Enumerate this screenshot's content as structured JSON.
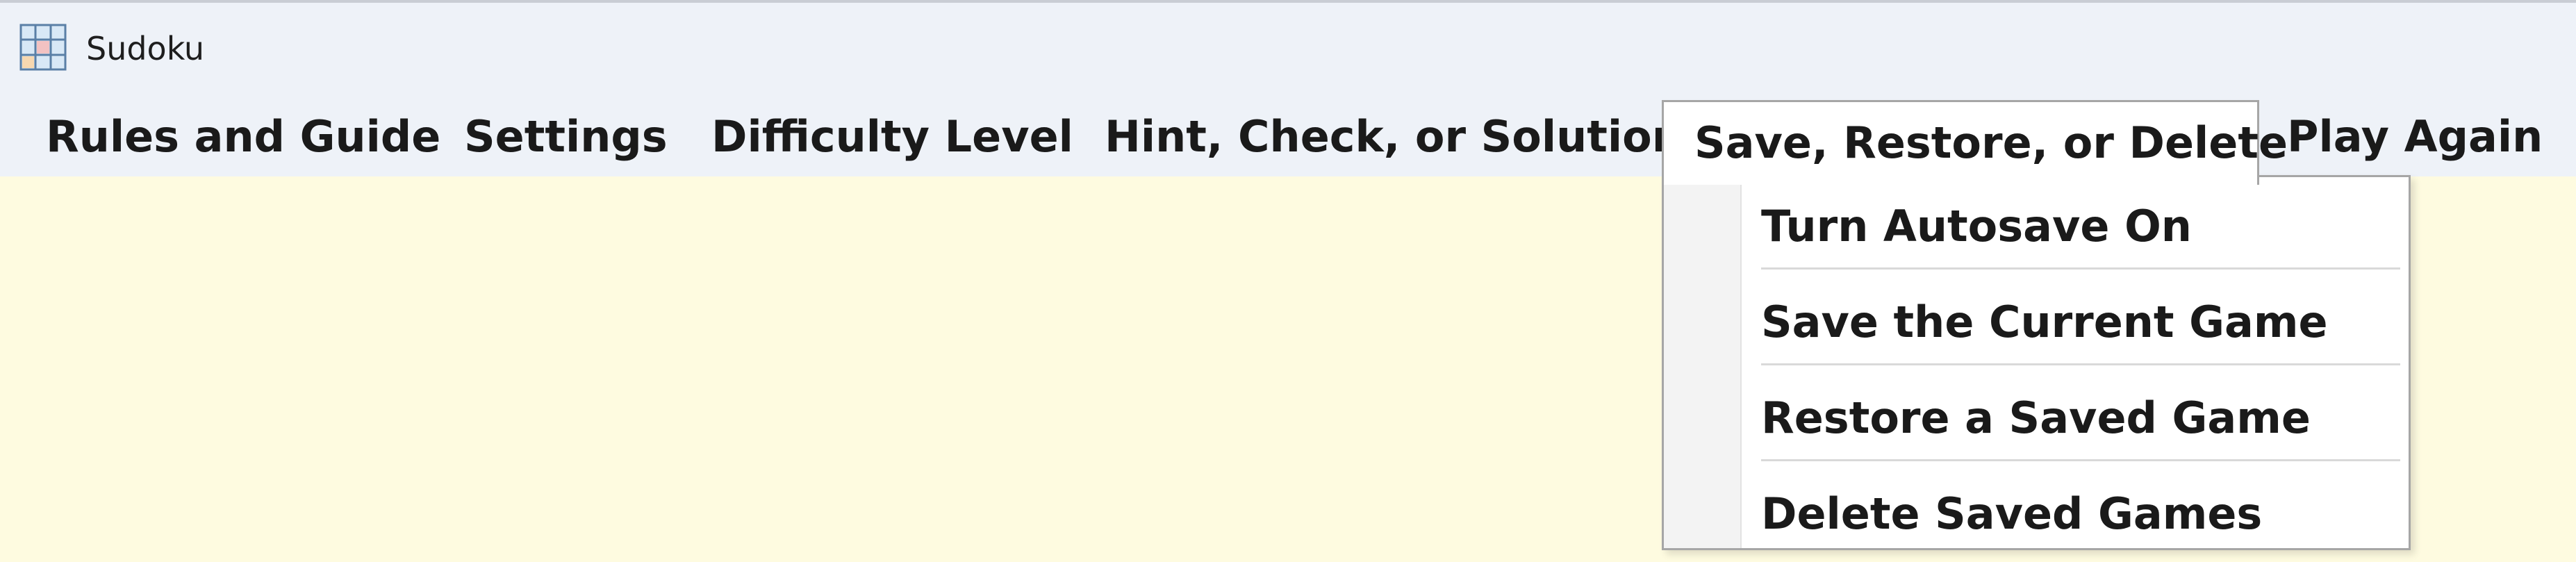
{
  "window": {
    "title": "Sudoku",
    "app_icon": "sudoku-grid-icon"
  },
  "menubar": {
    "items": [
      {
        "label": "Rules and Guide"
      },
      {
        "label": "Settings"
      },
      {
        "label": "Difficulty Level"
      },
      {
        "label": "Hint, Check, or Solution"
      },
      {
        "label": "Save, Restore, or Delete",
        "open": true
      },
      {
        "label": "Play Again"
      }
    ]
  },
  "dropdown": {
    "items": [
      {
        "label": "Turn Autosave On"
      },
      {
        "label": "Save the Current Game"
      },
      {
        "label": "Restore a Saved Game"
      },
      {
        "label": "Delete Saved Games"
      }
    ]
  },
  "colors": {
    "content_background": "#fefbe0",
    "bar_background": "#eef2f8",
    "menu_open_background": "#ffffff",
    "border": "#a6a6a6"
  }
}
